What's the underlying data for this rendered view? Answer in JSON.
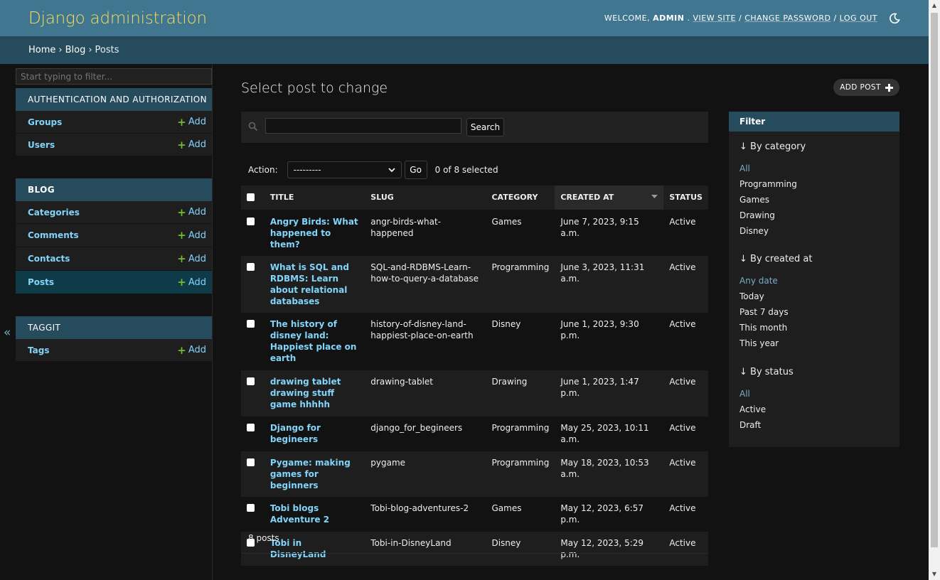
{
  "header": {
    "branding": "Django administration",
    "welcome": "Welcome,",
    "user": "admin",
    "view_site": "View site",
    "change_password": "Change password",
    "log_out": "Log out",
    "sep": "/"
  },
  "breadcrumbs": {
    "home": "Home",
    "blog": "Blog",
    "posts": "Posts",
    "sep": "›"
  },
  "nav": {
    "filter_placeholder": "Start typing to filter...",
    "collapse": "«",
    "auth": {
      "caption": "Authentication and Authorization",
      "items": [
        {
          "name": "Groups",
          "add": "Add"
        },
        {
          "name": "Users",
          "add": "Add"
        }
      ]
    },
    "blog": {
      "caption": "Blog",
      "items": [
        {
          "name": "Categories",
          "add": "Add"
        },
        {
          "name": "Comments",
          "add": "Add"
        },
        {
          "name": "Contacts",
          "add": "Add"
        },
        {
          "name": "Posts",
          "add": "Add"
        }
      ]
    },
    "taggit": {
      "caption": "Taggit",
      "items": [
        {
          "name": "Tags",
          "add": "Add"
        }
      ]
    }
  },
  "content": {
    "title": "Select post to change",
    "add_button": "Add post",
    "search_button": "Search",
    "search_value": "",
    "action_label": "Action:",
    "action_selected": "---------",
    "go": "Go",
    "counter": "0 of 8 selected",
    "paginator": "8 posts"
  },
  "table": {
    "headers": [
      "Title",
      "Slug",
      "Category",
      "Created at",
      "Status"
    ],
    "rows": [
      {
        "title": "Angry Birds: What happened to them?",
        "slug": "angr-birds-what-happened",
        "category": "Games",
        "created": "June 7, 2023, 9:15 a.m.",
        "status": "Active"
      },
      {
        "title": "What is SQL and RDBMS: Learn about relational databases",
        "slug": "SQL-and-RDBMS-Learn-how-to-query-a-database",
        "category": "Programming",
        "created": "June 3, 2023, 11:31 a.m.",
        "status": "Active"
      },
      {
        "title": "The history of disney land: Happiest place on earth",
        "slug": "history-of-disney-land-happiest-place-on-earth",
        "category": "Disney",
        "created": "June 1, 2023, 9:30 p.m.",
        "status": "Active"
      },
      {
        "title": "drawing tablet drawing stuff game hhhhh",
        "slug": "drawing-tablet",
        "category": "Drawing",
        "created": "June 1, 2023, 1:47 p.m.",
        "status": "Active"
      },
      {
        "title": "Django for begineers",
        "slug": "django_for_begineers",
        "category": "Programming",
        "created": "May 25, 2023, 10:11 a.m.",
        "status": "Active"
      },
      {
        "title": "Pygame: making games for beginners",
        "slug": "pygame",
        "category": "Programming",
        "created": "May 18, 2023, 10:53 a.m.",
        "status": "Active"
      },
      {
        "title": "Tobi blogs Adventure 2",
        "slug": "Tobi-blog-adventures-2",
        "category": "Games",
        "created": "May 12, 2023, 6:57 p.m.",
        "status": "Active"
      },
      {
        "title": "Tobi in DisneyLand",
        "slug": "Tobi-in-DisneyLand",
        "category": "Disney",
        "created": "May 12, 2023, 5:29 p.m.",
        "status": "Active"
      }
    ]
  },
  "filter": {
    "title": "Filter",
    "groups": [
      {
        "title": "↓ By category",
        "options": [
          "All",
          "Programming",
          "Games",
          "Drawing",
          "Disney"
        ]
      },
      {
        "title": "↓ By created at",
        "options": [
          "Any date",
          "Today",
          "Past 7 days",
          "This month",
          "This year"
        ]
      },
      {
        "title": "↓ By status",
        "options": [
          "All",
          "Active",
          "Draft"
        ]
      }
    ]
  },
  "colors": {
    "header_bg": "#417690",
    "breadcrumb_bg": "#264b5d",
    "branding": "#f5dd5d",
    "link": "#81d4fa",
    "add_plus": "#70bf2b",
    "page_bg": "#121212"
  }
}
